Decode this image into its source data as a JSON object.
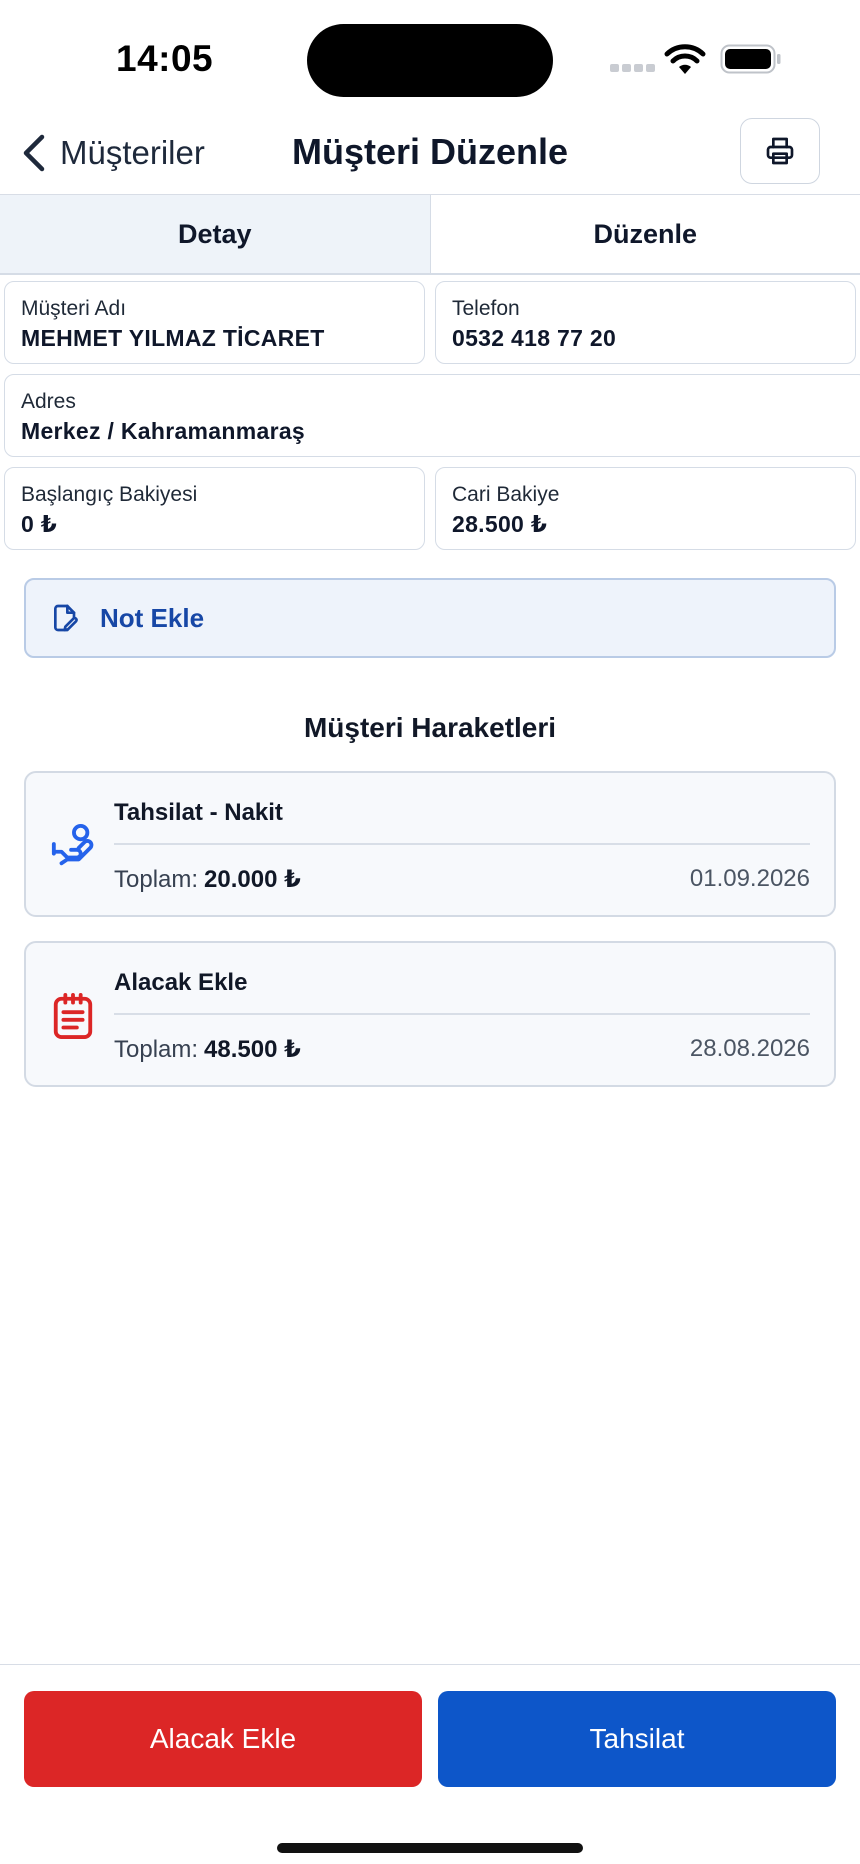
{
  "status_bar": {
    "time": "14:05"
  },
  "nav": {
    "back_label": "Müşteriler",
    "title": "Müşteri Düzenle"
  },
  "tabs": [
    {
      "label": "Detay",
      "active": true
    },
    {
      "label": "Düzenle",
      "active": false
    }
  ],
  "customer": {
    "name": {
      "label": "Müşteri Adı",
      "value": "MEHMET YILMAZ TİCARET"
    },
    "phone": {
      "label": "Telefon",
      "value": "0532 418 77 20"
    },
    "address": {
      "label": "Adres",
      "value": "Merkez / Kahramanmaraş"
    },
    "opening_balance": {
      "label": "Başlangıç Bakiyesi",
      "value": "0 ₺"
    },
    "current_balance": {
      "label": "Cari Bakiye",
      "value": "28.500 ₺"
    }
  },
  "note_button": {
    "label": "Not Ekle",
    "icon": "note-icon"
  },
  "movements": {
    "title": "Müşteri Haraketleri",
    "items": [
      {
        "title": "Tahsilat - Nakit",
        "total_label": "Toplam:",
        "amount": "20.000 ₺",
        "date": "01.09.2026",
        "icon": "hand-money-icon",
        "icon_color": "#2563eb"
      },
      {
        "title": "Alacak Ekle",
        "total_label": "Toplam:",
        "amount": "48.500 ₺",
        "date": "28.08.2026",
        "icon": "clipboard-icon",
        "icon_color": "#dc2626"
      }
    ]
  },
  "actions": {
    "add_receivable": {
      "label": "Alacak Ekle",
      "color": "#dc2626"
    },
    "collection": {
      "label": "Tahsilat",
      "color": "#0d56c9"
    }
  }
}
